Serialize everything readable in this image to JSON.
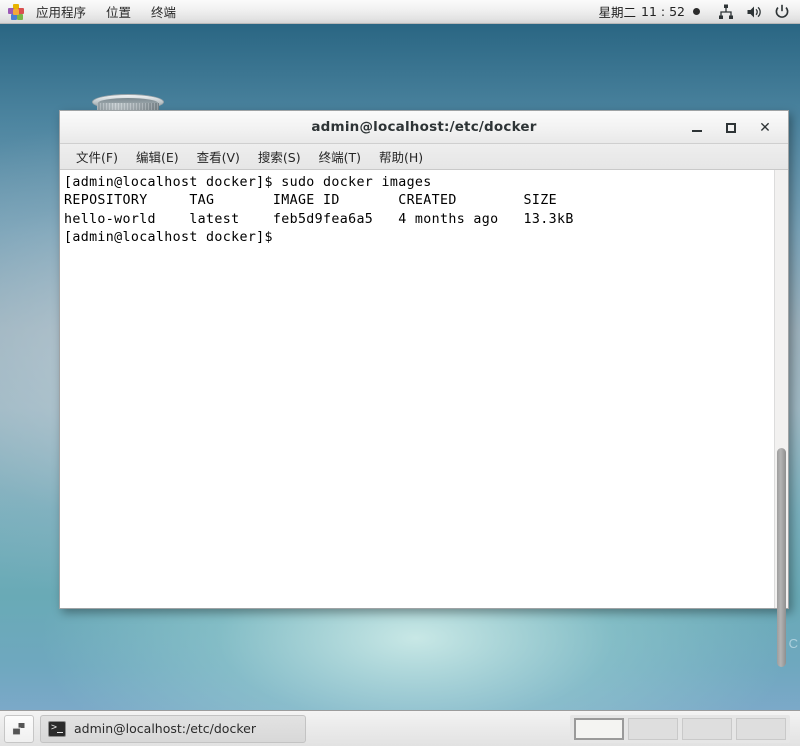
{
  "top_panel": {
    "app_icon": "applications-pinwheel-icon",
    "menus": [
      {
        "label": "应用程序",
        "name": "applications-menu"
      },
      {
        "label": "位置",
        "name": "places-menu"
      },
      {
        "label": "终端",
        "name": "terminal-menu"
      }
    ],
    "clock": {
      "weekday": "星期二",
      "time": "11 : 52",
      "indicator": "recording-dot-icon"
    },
    "tray": [
      {
        "name": "network-icon"
      },
      {
        "name": "volume-icon"
      },
      {
        "name": "power-icon"
      }
    ]
  },
  "desktop": {
    "trash_icon": "trash-can-icon",
    "edge_label": "C"
  },
  "window": {
    "title": "admin@localhost:/etc/docker",
    "buttons": {
      "minimize": "minimize-icon",
      "maximize": "maximize-icon",
      "close": "close-icon"
    },
    "menubar": [
      {
        "label": "文件(F)",
        "name": "menu-file"
      },
      {
        "label": "编辑(E)",
        "name": "menu-edit"
      },
      {
        "label": "查看(V)",
        "name": "menu-view"
      },
      {
        "label": "搜索(S)",
        "name": "menu-search"
      },
      {
        "label": "终端(T)",
        "name": "menu-terminal"
      },
      {
        "label": "帮助(H)",
        "name": "menu-help"
      }
    ],
    "terminal": {
      "lines": [
        "[admin@localhost docker]$ sudo docker images",
        "REPOSITORY     TAG       IMAGE ID       CREATED        SIZE",
        "hello-world    latest    feb5d9fea6a5   4 months ago   13.3kB",
        "[admin@localhost docker]$ "
      ],
      "text": "[admin@localhost docker]$ sudo docker images\nREPOSITORY     TAG       IMAGE ID       CREATED        SIZE\nhello-world    latest    feb5d9fea6a5   4 months ago   13.3kB\n[admin@localhost docker]$ ",
      "command": "sudo docker images",
      "prompt": "[admin@localhost docker]$",
      "table": {
        "headers": [
          "REPOSITORY",
          "TAG",
          "IMAGE ID",
          "CREATED",
          "SIZE"
        ],
        "rows": [
          [
            "hello-world",
            "latest",
            "feb5d9fea6a5",
            "4 months ago",
            "13.3kB"
          ]
        ]
      },
      "background": "#ffffff",
      "foreground": "#000000"
    }
  },
  "bottom_panel": {
    "show_desktop": "show-desktop-icon",
    "task_button": {
      "icon": "terminal-icon",
      "label": "admin@localhost:/etc/docker"
    },
    "workspaces": [
      {
        "name": "workspace-1",
        "active": true
      },
      {
        "name": "workspace-2",
        "active": false
      },
      {
        "name": "workspace-3",
        "active": false
      },
      {
        "name": "workspace-4",
        "active": false
      }
    ]
  },
  "colors": {
    "panel_bg": "#ececec",
    "window_bg": "#f2f1f0",
    "terminal_bg": "#ffffff",
    "desktop_top": "#2a6683",
    "desktop_mid": "#9fb9c4"
  }
}
